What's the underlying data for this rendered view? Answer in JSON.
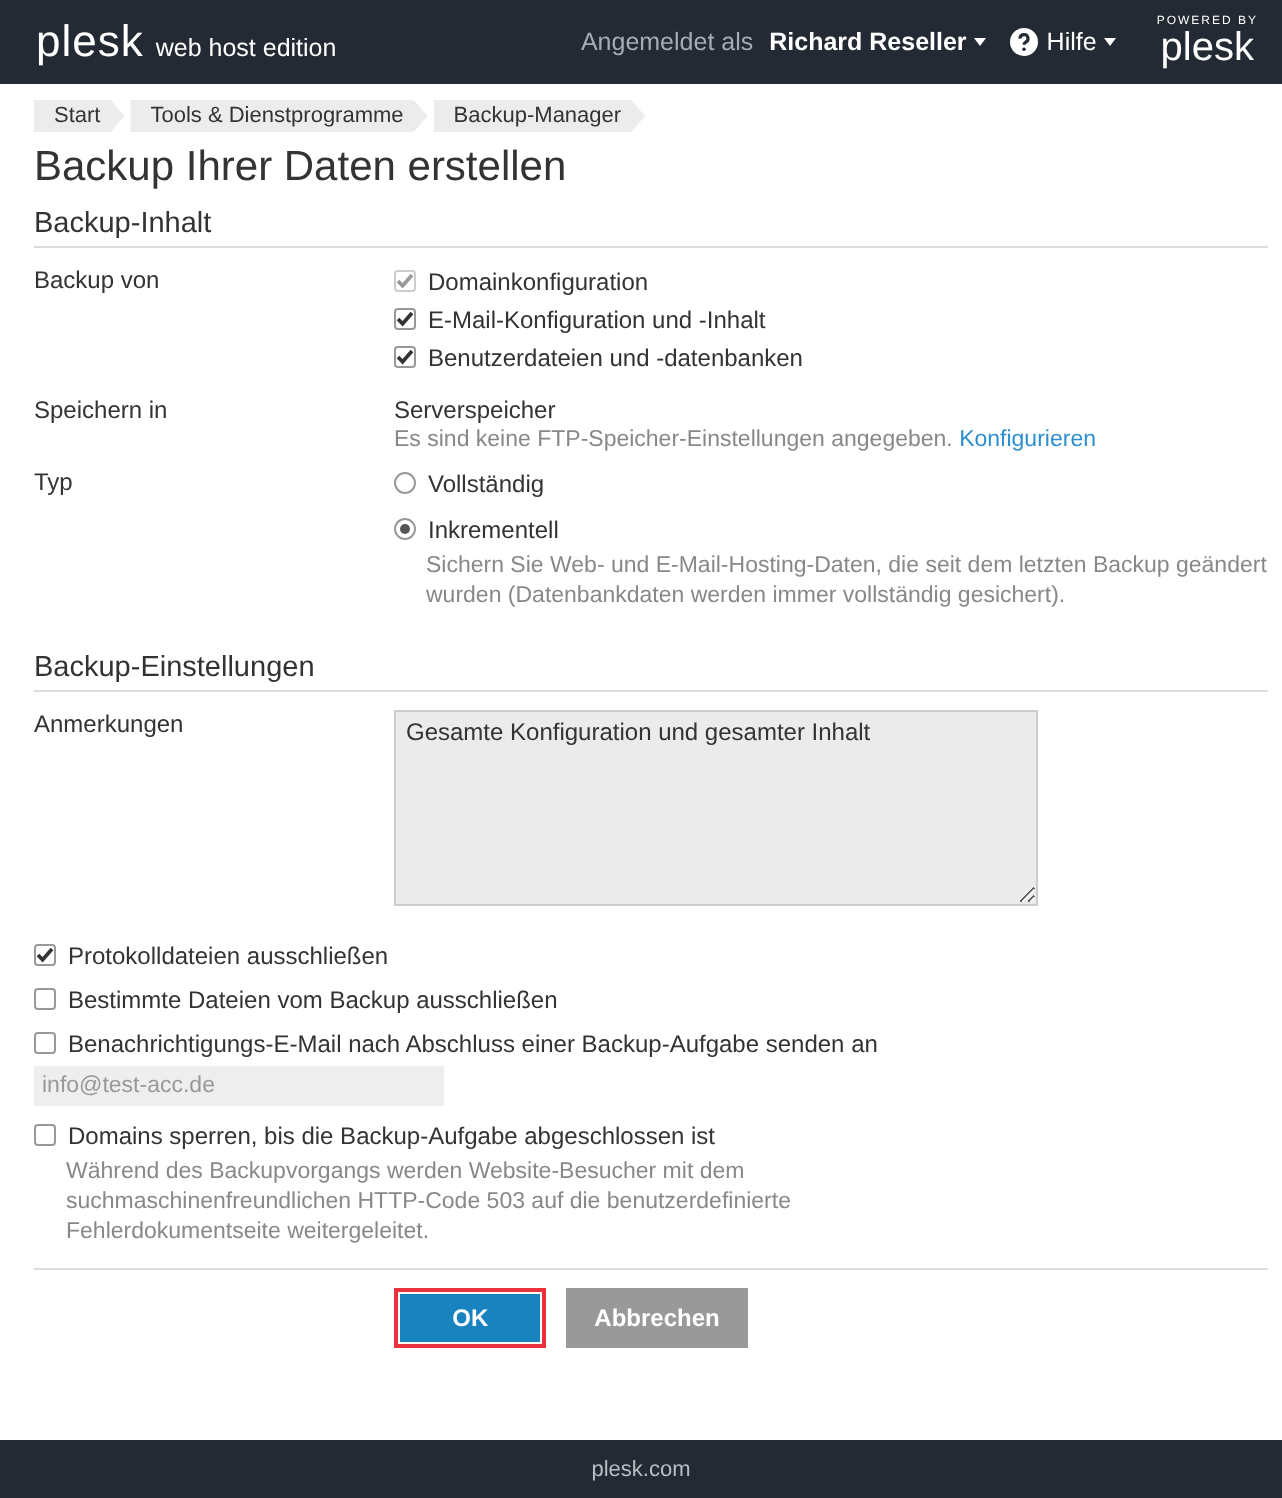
{
  "header": {
    "logo": "plesk",
    "edition": "web host edition",
    "login_label": "Angemeldet als",
    "user": "Richard Reseller",
    "help": "Hilfe",
    "powered_by": "POWERED BY",
    "powered_logo": "plesk"
  },
  "breadcrumbs": [
    "Start",
    "Tools & Dienstprogramme",
    "Backup-Manager"
  ],
  "title": "Backup Ihrer Daten erstellen",
  "sections": [
    {
      "title": "Backup-Inhalt",
      "rows": [
        {
          "kind": "checkboxes",
          "label": "Backup von",
          "options": [
            {
              "label": "Domainkonfiguration",
              "checked": true,
              "disabled": true
            },
            {
              "label": "E-Mail-Konfiguration und -Inhalt",
              "checked": true,
              "disabled": false
            },
            {
              "label": "Benutzerdateien und -datenbanken",
              "checked": true,
              "disabled": false
            }
          ]
        },
        {
          "kind": "storage",
          "label": "Speichern in",
          "value": "Serverspeicher",
          "note": "Es sind keine FTP-Speicher-Einstellungen angegeben.",
          "link": "Konfigurieren"
        },
        {
          "kind": "radios",
          "label": "Typ",
          "options": [
            {
              "label": "Vollständig",
              "selected": false
            },
            {
              "label": "Inkrementell",
              "selected": true,
              "hint": "Sichern Sie Web- und E-Mail-Hosting-Daten, die seit dem letzten Backup geändert wurden (Datenbankdaten werden immer vollständig gesichert)."
            }
          ]
        }
      ]
    },
    {
      "title": "Backup-Einstellungen",
      "rows": [
        {
          "kind": "textarea",
          "label": "Anmerkungen",
          "value": "Gesamte Konfiguration und gesamter Inhalt"
        }
      ],
      "options": [
        {
          "label": "Protokolldateien ausschließen",
          "checked": true
        },
        {
          "label": "Bestimmte Dateien vom Backup ausschließen",
          "checked": false
        },
        {
          "label": "Benachrichtigungs-E-Mail nach Abschluss einer Backup-Aufgabe senden an",
          "checked": false,
          "field": {
            "value": "info@test-acc.de",
            "disabled": true
          }
        },
        {
          "label": "Domains sperren, bis die Backup-Aufgabe abgeschlossen ist",
          "checked": false,
          "hint": "Während des Backupvorgangs werden Website-Besucher mit dem suchmaschinenfreundlichen HTTP-Code 503 auf die benutzerdefinierte Fehlerdokumentseite weitergeleitet."
        }
      ]
    }
  ],
  "buttons": [
    {
      "label": "OK",
      "kind": "primary",
      "focused": true
    },
    {
      "label": "Abbrechen",
      "kind": "secondary",
      "focused": false
    }
  ],
  "footer": "plesk.com"
}
